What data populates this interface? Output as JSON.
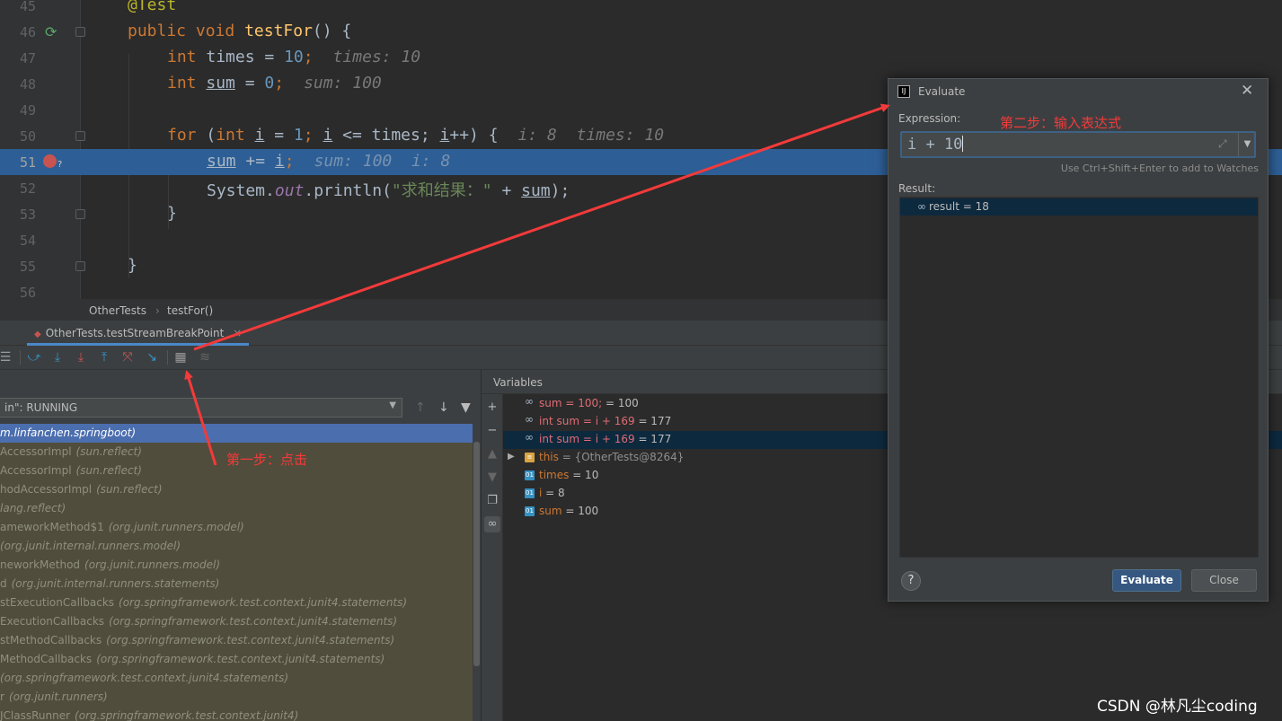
{
  "editor": {
    "lines": [
      {
        "num": "45"
      },
      {
        "num": "46"
      },
      {
        "num": "47"
      },
      {
        "num": "48"
      },
      {
        "num": "49"
      },
      {
        "num": "50"
      },
      {
        "num": "51"
      },
      {
        "num": "52"
      },
      {
        "num": "53"
      },
      {
        "num": "54"
      },
      {
        "num": "55"
      },
      {
        "num": "56"
      }
    ],
    "code": {
      "l45_ann": "@Test",
      "l46_kw": "public void",
      "l46_fn": "testFor",
      "l46_rest": "() {",
      "l47_kw": "int",
      "l47_code": "times = ",
      "l47_num": "10",
      "l47_semi": ";",
      "l47_hint": "times: 10",
      "l48_kw": "int",
      "l48_var": "sum",
      "l48_eq": " = ",
      "l48_num": "0",
      "l48_semi": ";",
      "l48_hint": "sum: 100",
      "l50_kw1": "for",
      "l50_p1": " (",
      "l50_kw2": "int",
      "l50_i1": "i",
      "l50_p2": " = ",
      "l50_num1": "1",
      "l50_p3": "; ",
      "l50_i2": "i",
      "l50_p4": " <= times; ",
      "l50_i3": "i",
      "l50_p5": "++) {",
      "l50_hint": "i: 8  times: 10",
      "l51_var": "sum",
      "l51_op": " += ",
      "l51_i": "i",
      "l51_semi": ";",
      "l51_hint": "sum: 100  i: 8",
      "l52_a": "System.",
      "l52_fld": "out",
      "l52_b": ".println(",
      "l52_str": "\"求和结果：\"",
      "l52_c": " + ",
      "l52_var": "sum",
      "l52_d": ");",
      "l53": "}",
      "l55": "}"
    }
  },
  "breadcrumb": {
    "class": "OtherTests",
    "sep": "›",
    "method": "testFor()"
  },
  "debug": {
    "tab_label": "OtherTests.testStreamBreakPoint",
    "tab_close": "×",
    "thread": "in\": RUNNING",
    "frames": [
      {
        "name": "",
        "pkg": "m.linfanchen.springboot)"
      },
      {
        "name": "AccessorImpl",
        "pkg": "(sun.reflect)"
      },
      {
        "name": "AccessorImpl",
        "pkg": "(sun.reflect)"
      },
      {
        "name": "hodAccessorImpl",
        "pkg": "(sun.reflect)"
      },
      {
        "name": "",
        "pkg": "lang.reflect)"
      },
      {
        "name": "ameworkMethod$1",
        "pkg": "(org.junit.runners.model)"
      },
      {
        "name": "",
        "pkg": "(org.junit.internal.runners.model)"
      },
      {
        "name": "neworkMethod",
        "pkg": "(org.junit.runners.model)"
      },
      {
        "name": "d",
        "pkg": "(org.junit.internal.runners.statements)"
      },
      {
        "name": "stExecutionCallbacks",
        "pkg": "(org.springframework.test.context.junit4.statements)"
      },
      {
        "name": "ExecutionCallbacks",
        "pkg": "(org.springframework.test.context.junit4.statements)"
      },
      {
        "name": "stMethodCallbacks",
        "pkg": "(org.springframework.test.context.junit4.statements)"
      },
      {
        "name": "MethodCallbacks",
        "pkg": "(org.springframework.test.context.junit4.statements)"
      },
      {
        "name": "",
        "pkg": "(org.springframework.test.context.junit4.statements)"
      },
      {
        "name": "r",
        "pkg": "(org.junit.runners)"
      },
      {
        "name": "JClassRunner",
        "pkg": "(org.springframework.test.context.junit4)"
      }
    ]
  },
  "variables": {
    "title": "Variables",
    "rows": [
      {
        "name": "sum = 100;",
        "value": " = 100"
      },
      {
        "name": "int sum = i + 169",
        "value": " = 177"
      },
      {
        "name": "int sum = i + 169",
        "value": " = 177"
      },
      {
        "arrow": "▶",
        "name": "this",
        "value": " = {OtherTests@8264}"
      },
      {
        "name": "times",
        "value": " = 10"
      },
      {
        "name": "i",
        "value": " = 8"
      },
      {
        "name": "sum",
        "value": " = 100"
      }
    ]
  },
  "evaluate": {
    "title": "Evaluate",
    "close_glyph": "✕",
    "expression_label": "Expression:",
    "expression_value": "i + 10",
    "hint": "Use Ctrl+Shift+Enter to add to Watches",
    "result_label": "Result:",
    "result": "result = 18",
    "help": "?",
    "evaluate_button": "Evaluate",
    "close_button": "Close"
  },
  "annotations": {
    "step1": "第一步：点击",
    "step2": "第二步：输入表达式",
    "color": "#f33a3a"
  },
  "watermark": "CSDN @林凡尘coding",
  "icons": {
    "rerun": "rerun-icon",
    "breakpoint": "breakpoint-icon",
    "watch": "glasses-icon",
    "calculator": "evaluate-expression-icon"
  }
}
